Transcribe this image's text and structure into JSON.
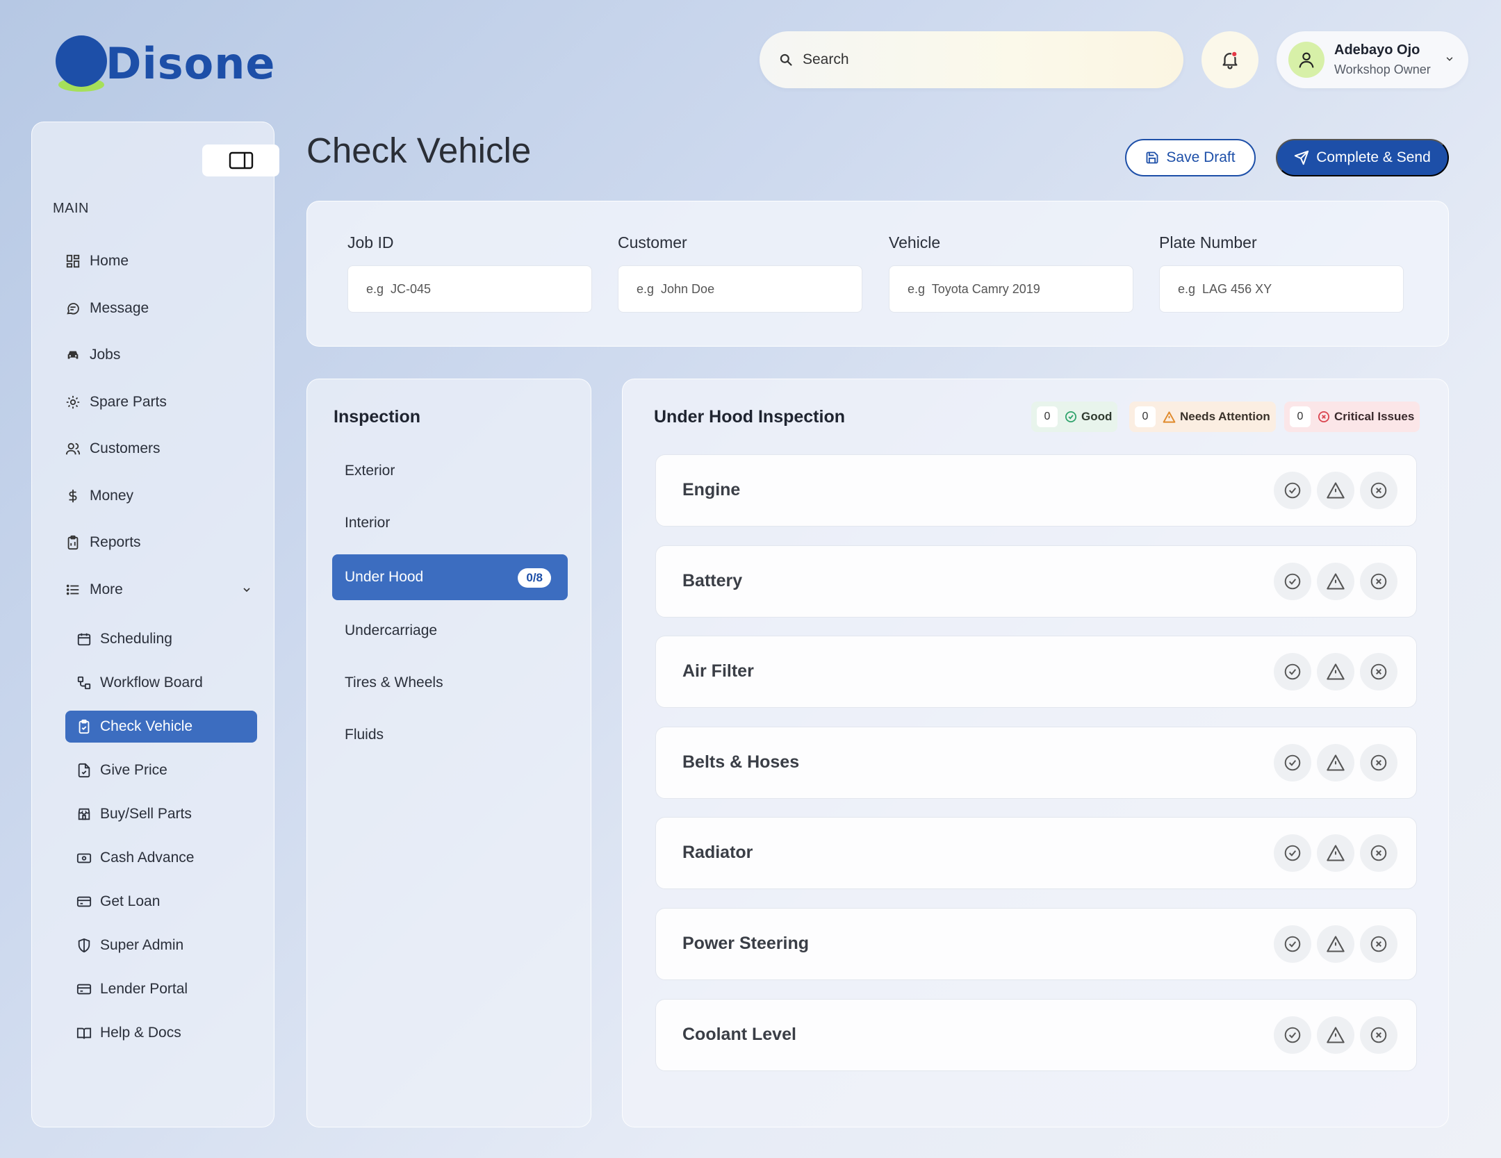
{
  "brand": {
    "name": "Disone",
    "primary": "#1d4fa8",
    "accent": "#a6e05a"
  },
  "topbar": {
    "search_placeholder": "Search",
    "notification_icon": "bell-icon",
    "user": {
      "name": "Adebayo Ojo",
      "role": "Workshop Owner"
    }
  },
  "sidebar": {
    "section_label": "MAIN",
    "items": [
      {
        "label": "Home",
        "icon": "grid-icon"
      },
      {
        "label": "Message",
        "icon": "chat-icon"
      },
      {
        "label": "Jobs",
        "icon": "car-icon"
      },
      {
        "label": "Spare Parts",
        "icon": "gear-icon"
      },
      {
        "label": "Customers",
        "icon": "users-icon"
      },
      {
        "label": "Money",
        "icon": "dollar-icon"
      },
      {
        "label": "Reports",
        "icon": "clipboard-icon"
      },
      {
        "label": "More",
        "icon": "list-icon"
      }
    ],
    "more_items": [
      {
        "label": "Scheduling",
        "icon": "calendar-icon"
      },
      {
        "label": "Workflow Board",
        "icon": "workflow-icon"
      },
      {
        "label": "Check Vehicle",
        "icon": "clipboard-check-icon",
        "active": true
      },
      {
        "label": "Give Price",
        "icon": "file-check-icon"
      },
      {
        "label": "Buy/Sell Parts",
        "icon": "store-icon"
      },
      {
        "label": "Cash Advance",
        "icon": "cash-icon"
      },
      {
        "label": "Get Loan",
        "icon": "card-icon"
      },
      {
        "label": "Super Admin",
        "icon": "shield-icon"
      },
      {
        "label": "Lender Portal",
        "icon": "card-icon"
      },
      {
        "label": "Help & Docs",
        "icon": "book-icon"
      }
    ]
  },
  "page": {
    "title": "Check Vehicle",
    "save_draft_label": "Save Draft",
    "complete_label": "Complete & Send"
  },
  "form": {
    "job_id": {
      "label": "Job ID",
      "placeholder": "e.g  JC-045"
    },
    "customer": {
      "label": "Customer",
      "placeholder": "e.g  John Doe"
    },
    "vehicle": {
      "label": "Vehicle",
      "placeholder": "e.g  Toyota Camry 2019"
    },
    "plate": {
      "label": "Plate Number",
      "placeholder": "e.g  LAG 456 XY"
    }
  },
  "inspection": {
    "title": "Inspection",
    "categories": [
      {
        "label": "Exterior"
      },
      {
        "label": "Interior"
      },
      {
        "label": "Under Hood",
        "count": "0/8",
        "active": true
      },
      {
        "label": "Undercarriage"
      },
      {
        "label": "Tires & Wheels"
      },
      {
        "label": "Fluids"
      }
    ]
  },
  "panel": {
    "title": "Under Hood Inspection",
    "summary": {
      "good": {
        "count": "0",
        "label": "Good",
        "color": "#2fa36b"
      },
      "attention": {
        "count": "0",
        "label": "Needs Attention",
        "color": "#e08a2c"
      },
      "critical": {
        "count": "0",
        "label": "Critical Issues",
        "color": "#d9434e"
      }
    },
    "items": [
      {
        "label": "Engine"
      },
      {
        "label": "Battery"
      },
      {
        "label": "Air Filter"
      },
      {
        "label": "Belts & Hoses"
      },
      {
        "label": "Radiator"
      },
      {
        "label": "Power Steering"
      },
      {
        "label": "Coolant Level"
      }
    ]
  }
}
